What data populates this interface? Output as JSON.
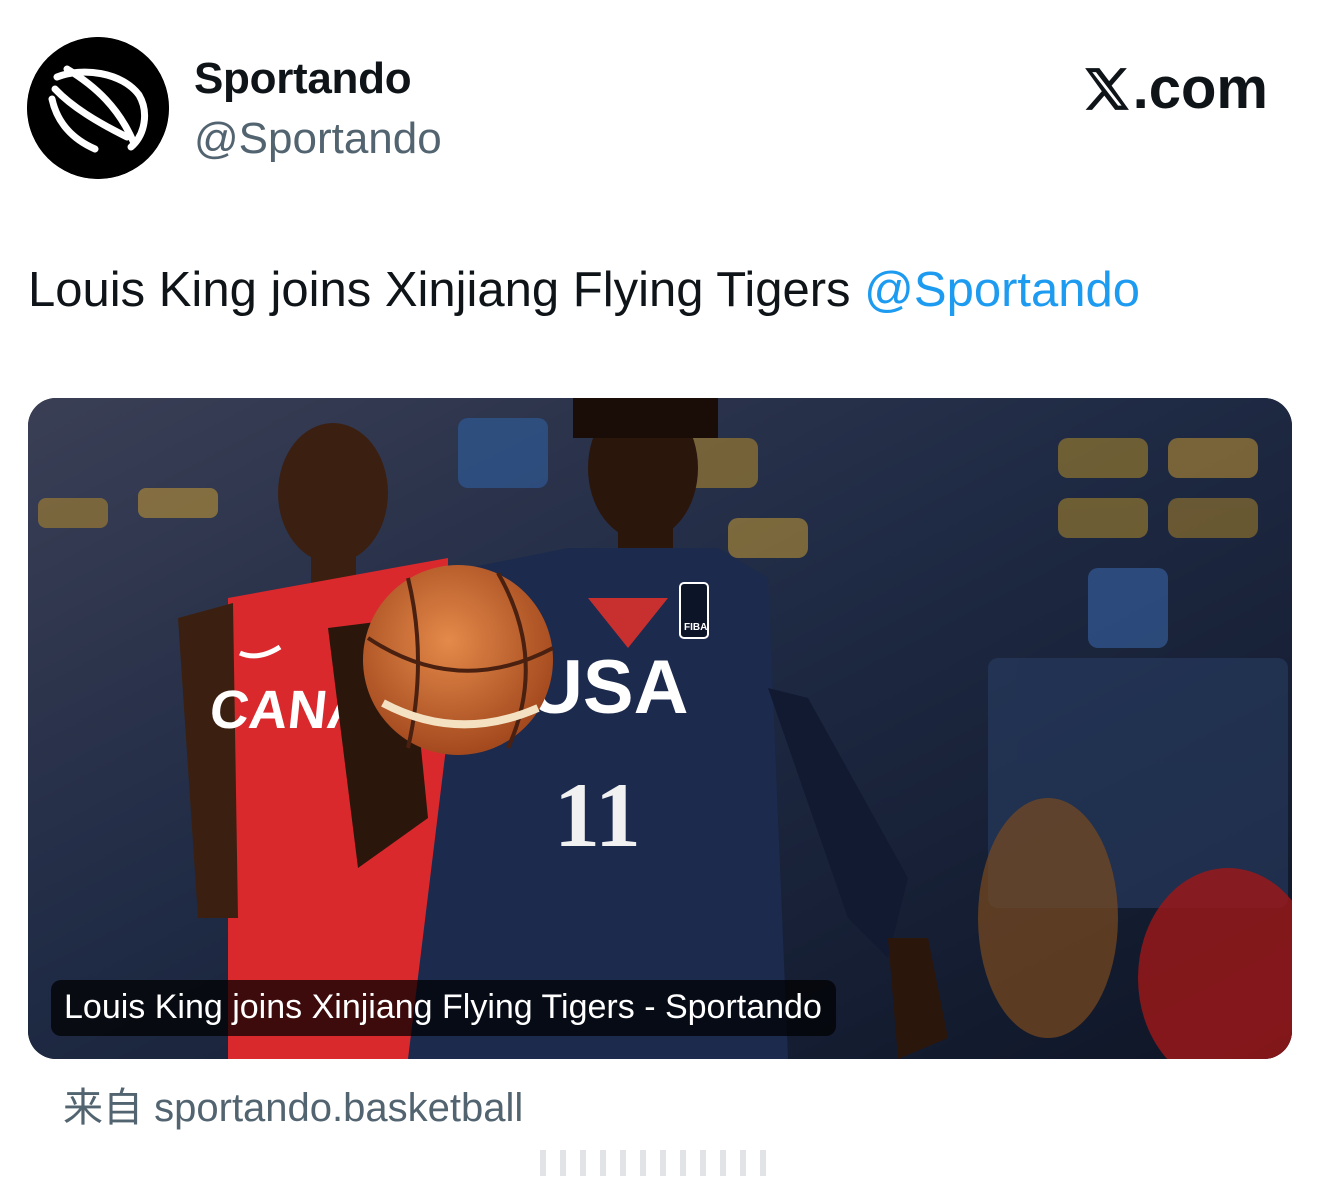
{
  "header": {
    "display_name": "Sportando",
    "handle": "@Sportando",
    "avatar_icon": "basketball-logo-icon",
    "brand_icon": "x-logo-icon",
    "brand_suffix": ".com"
  },
  "tweet": {
    "text": "Louis King joins Xinjiang Flying Tigers ",
    "mention": "@Sportando"
  },
  "card": {
    "caption": "Louis King joins Xinjiang Flying Tigers - Sportando",
    "image_text": {
      "front_jersey": "USA",
      "front_number": "11",
      "back_jersey": "CANA",
      "badge": "FIBA"
    }
  },
  "source": {
    "prefix": "来自",
    "domain": "sportando.basketball"
  },
  "colors": {
    "text": "#0f1419",
    "secondary": "#536471",
    "link": "#1d9bf0"
  }
}
